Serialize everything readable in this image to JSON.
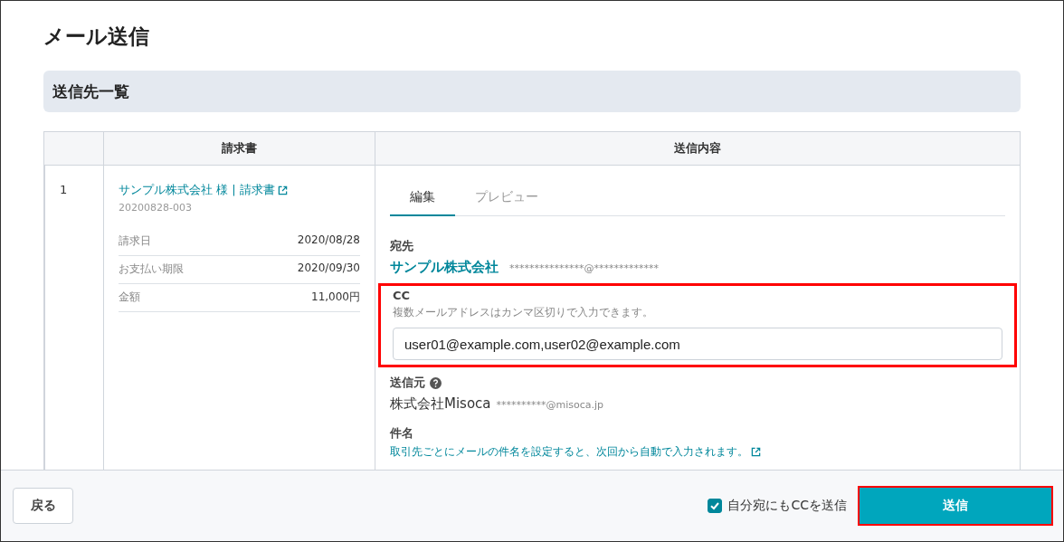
{
  "title": "メール送信",
  "section_title": "送信先一覧",
  "table": {
    "columns": [
      "",
      "請求書",
      "送信内容"
    ],
    "rows": [
      {
        "index": "1",
        "invoice_link": "サンプル株式会社 様 | 請求書",
        "invoice_number": "20200828-003",
        "details": [
          {
            "label": "請求日",
            "value": "2020/08/28"
          },
          {
            "label": "お支払い期限",
            "value": "2020/09/30"
          },
          {
            "label": "金額",
            "value": "11,000円"
          }
        ],
        "tabs": [
          {
            "label": "編集",
            "selected": true
          },
          {
            "label": "プレビュー",
            "selected": false
          }
        ],
        "to": {
          "label": "宛先",
          "name": "サンプル株式会社",
          "email": "***************@*************"
        },
        "cc": {
          "label": "CC",
          "hint": "複数メールアドレスはカンマ区切りで入力できます。",
          "value": "user01@example.com,user02@example.com",
          "highlighted": true
        },
        "from": {
          "label": "送信元",
          "name": "株式会社Misoca",
          "email": "**********@misoca.jp"
        },
        "subject": {
          "label": "件名",
          "hint_link": "取引先ごとにメールの件名を設定すると、次回から自動で入力されます。"
        }
      }
    ]
  },
  "footer": {
    "back_button": "戻る",
    "cc_self": {
      "label": "自分宛にもCCを送信",
      "checked": true
    },
    "send_button": {
      "label": "送信",
      "highlighted": true
    }
  }
}
